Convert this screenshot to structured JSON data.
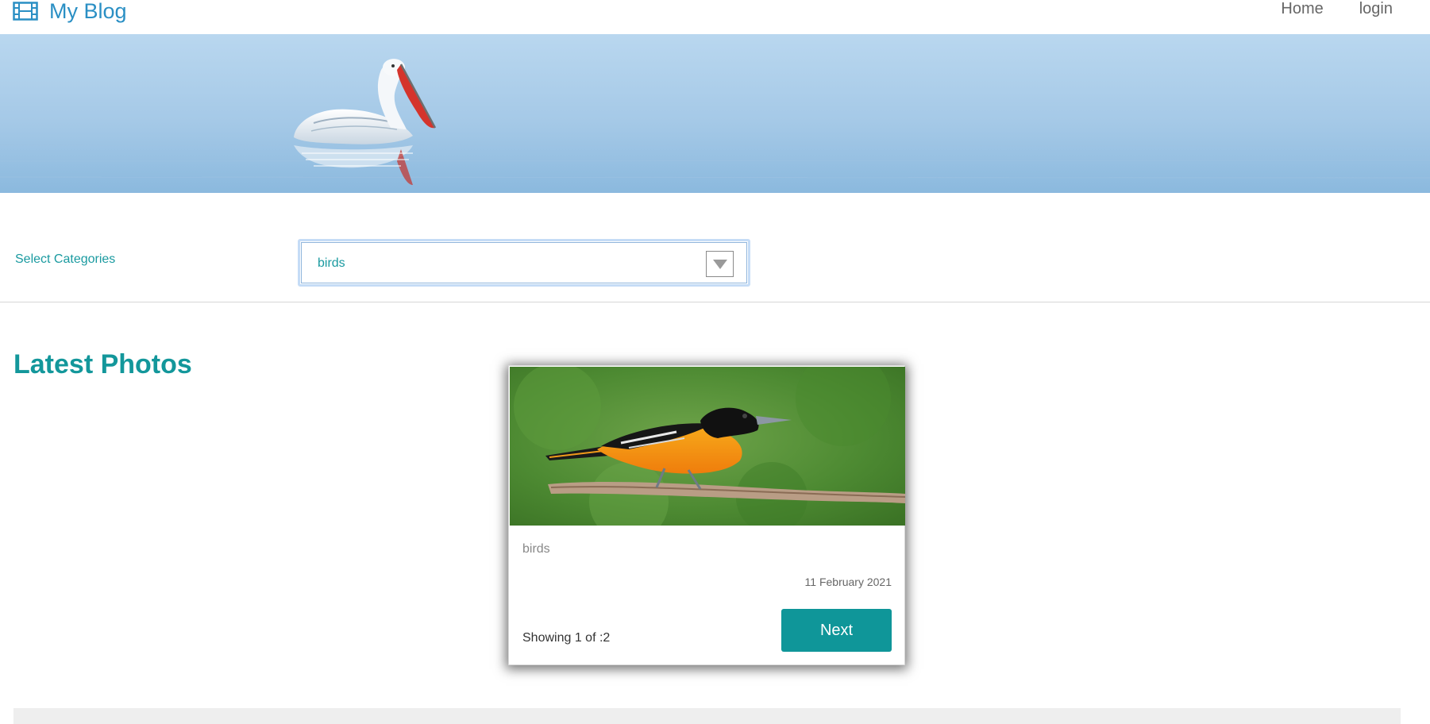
{
  "nav": {
    "brand": "My Blog",
    "links": [
      "Home",
      "login"
    ]
  },
  "filter": {
    "label": "Select Categories",
    "selected": "birds"
  },
  "content": {
    "title": "Latest Photos"
  },
  "card": {
    "category": "birds",
    "date": "11 February 2021",
    "count": "Showing 1 of :2",
    "next_label": "Next"
  },
  "icons": {
    "brand": "film-icon",
    "select": "chevron-down-icon"
  },
  "colors": {
    "brand": "#2a8fc4",
    "accent": "#13979b",
    "button": "#0f9699"
  }
}
